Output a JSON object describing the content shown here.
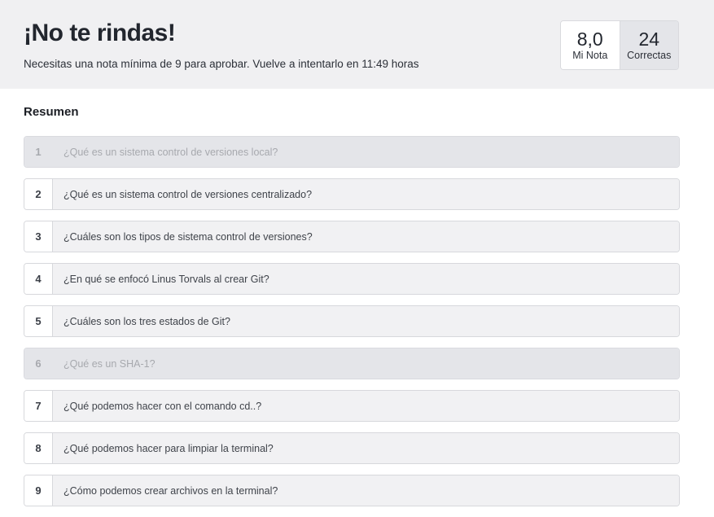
{
  "header": {
    "title": "¡No te rindas!",
    "subtitle": "Necesitas una nota mínima de 9 para aprobar. Vuelve a intentarlo en 11:49 horas"
  },
  "stats": {
    "grade_value": "8,0",
    "grade_label": "Mi Nota",
    "correct_value": "24",
    "correct_label": "Correctas"
  },
  "summary": {
    "title": "Resumen",
    "questions": [
      {
        "number": "1",
        "text": "¿Qué es un sistema control de versiones local?",
        "disabled": true
      },
      {
        "number": "2",
        "text": "¿Qué es un sistema control de versiones centralizado?",
        "disabled": false
      },
      {
        "number": "3",
        "text": "¿Cuáles son los tipos de sistema control de versiones?",
        "disabled": false
      },
      {
        "number": "4",
        "text": "¿En qué se enfocó Linus Torvals al crear Git?",
        "disabled": false
      },
      {
        "number": "5",
        "text": "¿Cuáles son los tres estados de Git?",
        "disabled": false
      },
      {
        "number": "6",
        "text": "¿Qué es un SHA-1?",
        "disabled": true
      },
      {
        "number": "7",
        "text": "¿Qué podemos hacer con el comando cd..?",
        "disabled": false
      },
      {
        "number": "8",
        "text": "¿Qué podemos hacer para limpiar la terminal?",
        "disabled": false
      },
      {
        "number": "9",
        "text": "¿Cómo podemos crear archivos en la terminal?",
        "disabled": false
      }
    ]
  }
}
